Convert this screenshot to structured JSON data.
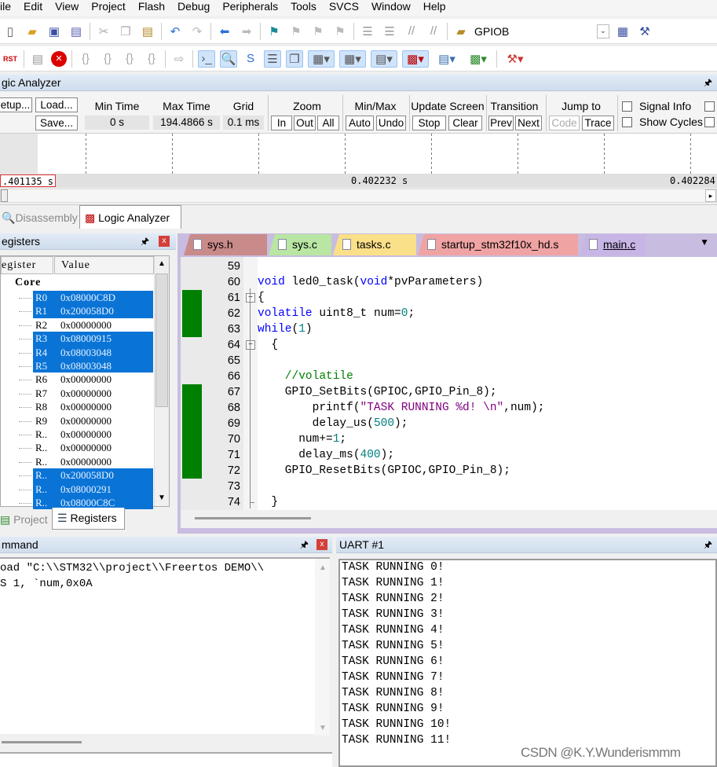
{
  "menu": [
    "ile",
    "Edit",
    "View",
    "Project",
    "Flash",
    "Debug",
    "Peripherals",
    "Tools",
    "SVCS",
    "Window",
    "Help"
  ],
  "toolbar1": {
    "target": "GPIOB"
  },
  "logic_analyzer": {
    "title": "gic Analyzer",
    "setup": "etup...",
    "load": "Load...",
    "save": "Save...",
    "min_time_label": "Min Time",
    "min_time": "0 s",
    "max_time_label": "Max Time",
    "max_time": "194.4866 s",
    "grid_label": "Grid",
    "grid": "0.1 ms",
    "zoom_label": "Zoom",
    "zoom_in": "In",
    "zoom_out": "Out",
    "zoom_all": "All",
    "minmax_label": "Min/Max",
    "auto": "Auto",
    "undo": "Undo",
    "update_label": "Update Screen",
    "stop": "Stop",
    "clear": "Clear",
    "transition_label": "Transition",
    "prev": "Prev",
    "next": "Next",
    "jump_label": "Jump to",
    "code": "Code",
    "trace": "Trace",
    "signal_info": "Signal Info",
    "show_cycles": "Show Cycles",
    "cursor_time": ".401135 s",
    "mid_time": "0.402232 s",
    "right_time": "0.402284"
  },
  "view_tabs": [
    "Disassembly",
    "Logic Analyzer"
  ],
  "registers": {
    "title": "egisters",
    "col_register": "egister",
    "col_value": "Value",
    "group": "Core",
    "rows": [
      {
        "name": "R0",
        "value": "0x08000C8D",
        "changed": true
      },
      {
        "name": "R1",
        "value": "0x200058D0",
        "changed": true
      },
      {
        "name": "R2",
        "value": "0x00000000",
        "changed": false
      },
      {
        "name": "R3",
        "value": "0x08000915",
        "changed": true
      },
      {
        "name": "R4",
        "value": "0x08003048",
        "changed": true
      },
      {
        "name": "R5",
        "value": "0x08003048",
        "changed": true
      },
      {
        "name": "R6",
        "value": "0x00000000",
        "changed": false
      },
      {
        "name": "R7",
        "value": "0x00000000",
        "changed": false
      },
      {
        "name": "R8",
        "value": "0x00000000",
        "changed": false
      },
      {
        "name": "R9",
        "value": "0x00000000",
        "changed": false
      },
      {
        "name": "R..",
        "value": "0x00000000",
        "changed": false
      },
      {
        "name": "R..",
        "value": "0x00000000",
        "changed": false
      },
      {
        "name": "R..",
        "value": "0x00000000",
        "changed": false
      },
      {
        "name": "R..",
        "value": "0x200058D0",
        "changed": true
      },
      {
        "name": "R..",
        "value": "0x08000291",
        "changed": true
      },
      {
        "name": "R..",
        "value": "0x08000C8C",
        "changed": true
      }
    ],
    "bottom_tabs": [
      "Project",
      "Registers"
    ]
  },
  "editor": {
    "tabs": [
      {
        "label": "sys.h",
        "color": "#c98a8a"
      },
      {
        "label": "sys.c",
        "color": "#b9e6a3"
      },
      {
        "label": "tasks.c",
        "color": "#fbe08a"
      },
      {
        "label": "startup_stm32f10x_hd.s",
        "color": "#f0a3a3"
      },
      {
        "label": "main.c",
        "color": "#c7b5e6",
        "active": true
      }
    ],
    "colors": {
      "kw": "#0000ff",
      "num": "#008080",
      "str": "#800080",
      "cmt": "#008000",
      "txt": "#000000"
    },
    "lines": [
      {
        "n": "59",
        "cov": false,
        "fold": "",
        "seg": []
      },
      {
        "n": "60",
        "cov": false,
        "fold": "",
        "seg": [
          [
            "kw",
            "void"
          ],
          [
            "txt",
            " led0_task("
          ],
          [
            "kw",
            "void"
          ],
          [
            "txt",
            "*pvParameters)"
          ]
        ]
      },
      {
        "n": "61",
        "cov": true,
        "fold": "minus",
        "seg": [
          [
            "txt",
            "{"
          ]
        ]
      },
      {
        "n": "62",
        "cov": true,
        "fold": "",
        "seg": [
          [
            "kw",
            "volatile"
          ],
          [
            "txt",
            " uint8_t num="
          ],
          [
            "num",
            "0"
          ],
          [
            "txt",
            ";"
          ]
        ]
      },
      {
        "n": "63",
        "cov": true,
        "fold": "",
        "seg": [
          [
            "kw",
            "while"
          ],
          [
            "txt",
            "("
          ],
          [
            "num",
            "1"
          ],
          [
            "txt",
            ")"
          ]
        ]
      },
      {
        "n": "64",
        "cov": false,
        "fold": "minus",
        "seg": [
          [
            "txt",
            "  {"
          ]
        ]
      },
      {
        "n": "65",
        "cov": false,
        "fold": "",
        "seg": []
      },
      {
        "n": "66",
        "cov": false,
        "fold": "",
        "seg": [
          [
            "cmt",
            "    //volatile"
          ]
        ]
      },
      {
        "n": "67",
        "cov": true,
        "fold": "",
        "seg": [
          [
            "txt",
            "    GPIO_SetBits(GPIOC,GPIO_Pin_8);"
          ]
        ]
      },
      {
        "n": "68",
        "cov": true,
        "fold": "",
        "seg": [
          [
            "txt",
            "        printf("
          ],
          [
            "str",
            "\"TASK RUNNING %d! \\n\""
          ],
          [
            "txt",
            ",num);"
          ]
        ]
      },
      {
        "n": "69",
        "cov": true,
        "fold": "",
        "seg": [
          [
            "txt",
            "        delay_us("
          ],
          [
            "num",
            "500"
          ],
          [
            "txt",
            ");"
          ]
        ]
      },
      {
        "n": "70",
        "cov": true,
        "fold": "",
        "seg": [
          [
            "txt",
            "      num+="
          ],
          [
            "num",
            "1"
          ],
          [
            "txt",
            ";"
          ]
        ]
      },
      {
        "n": "71",
        "cov": true,
        "fold": "",
        "seg": [
          [
            "txt",
            "      delay_ms("
          ],
          [
            "num",
            "400"
          ],
          [
            "txt",
            ");"
          ]
        ]
      },
      {
        "n": "72",
        "cov": true,
        "fold": "",
        "seg": [
          [
            "txt",
            "    GPIO_ResetBits(GPIOC,GPIO_Pin_8);"
          ]
        ]
      },
      {
        "n": "73",
        "cov": false,
        "fold": "",
        "seg": []
      },
      {
        "n": "74",
        "cov": false,
        "fold": "end",
        "seg": [
          [
            "txt",
            "  }"
          ]
        ]
      }
    ]
  },
  "command": {
    "title": "mmand",
    "lines": [
      "oad \"C:\\\\STM32\\\\project\\\\Freertos DEMO\\\\",
      "S 1, `num,0x0A"
    ]
  },
  "uart": {
    "title": "UART #1",
    "lines": [
      "TASK RUNNING 0!",
      "TASK RUNNING 1!",
      "TASK RUNNING 2!",
      "TASK RUNNING 3!",
      "TASK RUNNING 4!",
      "TASK RUNNING 5!",
      "TASK RUNNING 6!",
      "TASK RUNNING 7!",
      "TASK RUNNING 8!",
      "TASK RUNNING 9!",
      "TASK RUNNING 10!",
      "TASK RUNNING 11!"
    ]
  },
  "watermark": "CSDN @K.Y.Wunderismmm"
}
